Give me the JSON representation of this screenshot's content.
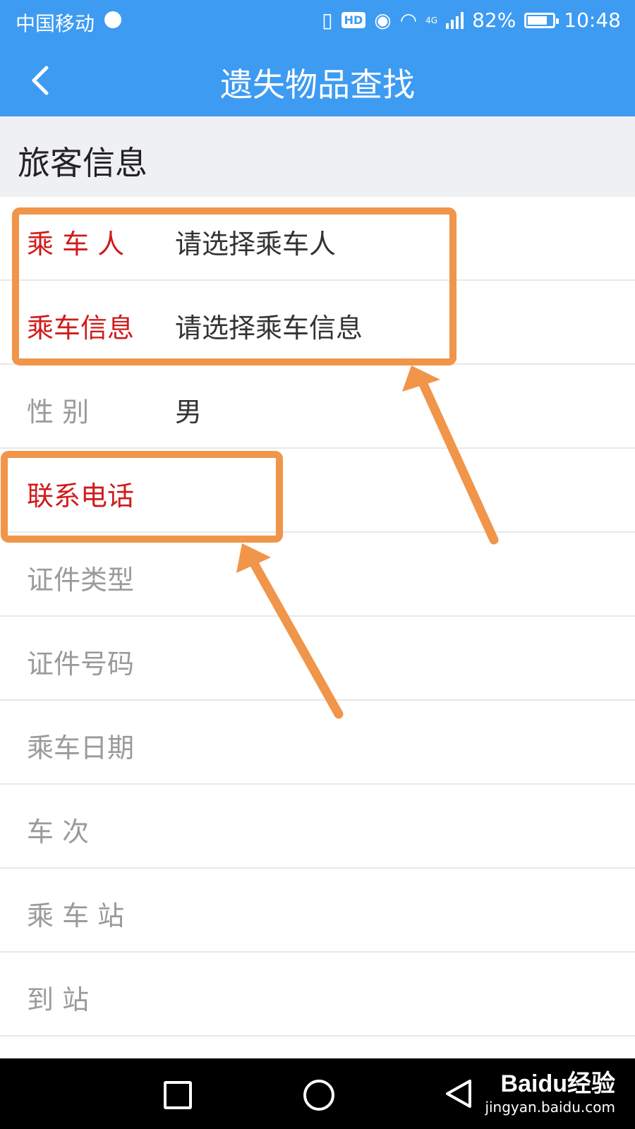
{
  "status_bar": {
    "carrier": "中国移动",
    "network_badge": "4G",
    "battery": "82%",
    "battery_level": 0.82,
    "time": "10:48"
  },
  "header": {
    "title": "遗失物品查找"
  },
  "section": {
    "title": "旅客信息"
  },
  "fields": [
    {
      "label": "乘  车  人",
      "value": "请选择乘车人",
      "required": true
    },
    {
      "label": "乘车信息",
      "value": "请选择乘车信息",
      "required": true
    },
    {
      "label": "性      别",
      "value": "男",
      "required": false
    },
    {
      "label": "联系电话",
      "value": "",
      "required": true
    },
    {
      "label": "证件类型",
      "value": "",
      "required": false
    },
    {
      "label": "证件号码",
      "value": "",
      "required": false
    },
    {
      "label": "乘车日期",
      "value": "",
      "required": false
    },
    {
      "label": "车      次",
      "value": "",
      "required": false
    },
    {
      "label": "乘  车  站",
      "value": "",
      "required": false
    },
    {
      "label": "到      站",
      "value": "",
      "required": false
    }
  ],
  "watermark": {
    "brand": "Baidu经验",
    "url": "jingyan.baidu.com"
  },
  "colors": {
    "primary": "#3d9bf2",
    "required": "#d01b1b",
    "annotation": "#f0954a"
  },
  "icons": {
    "back": "chevron-left-icon",
    "nav_recent": "square-icon",
    "nav_home": "circle-icon",
    "nav_back": "triangle-left-icon"
  }
}
